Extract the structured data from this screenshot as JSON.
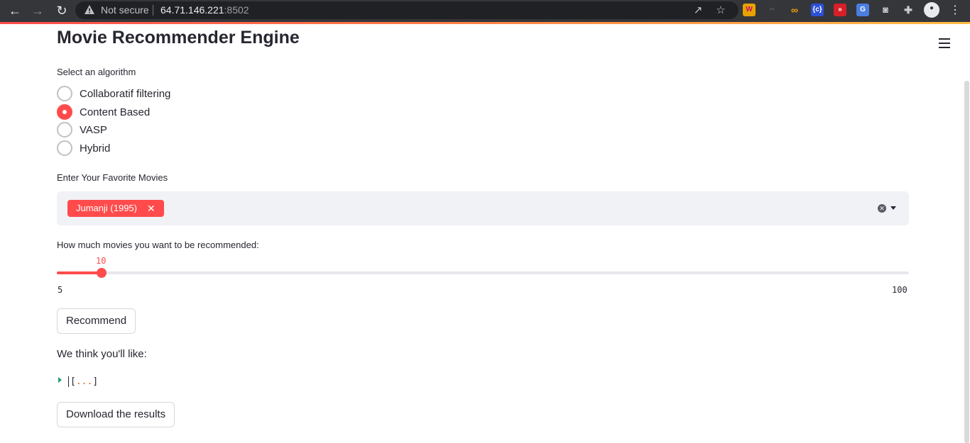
{
  "browser": {
    "security_label": "Not secure",
    "host": "64.71.146.221",
    "port": ":8502"
  },
  "app": {
    "title": "Movie Recommender Engine",
    "algorithm": {
      "label": "Select an algorithm",
      "options": [
        "Collaboratif filtering",
        "Content Based",
        "VASP",
        "Hybrid"
      ],
      "selected": "Content Based"
    },
    "favorites": {
      "label": "Enter Your Favorite Movies",
      "selected_tags": [
        "Jumanji (1995)"
      ]
    },
    "slider": {
      "label": "How much movies you want to be recommended:",
      "value": "10",
      "min": "5",
      "max": "100"
    },
    "recommend_button": "Recommend",
    "results_heading": "We think you'll like:",
    "results_json_open": "[",
    "results_json_dots": "...",
    "results_json_close": "]",
    "download_button": "Download the results"
  },
  "colors": {
    "primary": "#ff4b4b",
    "text": "#262730",
    "input_bg": "#f0f2f6"
  }
}
